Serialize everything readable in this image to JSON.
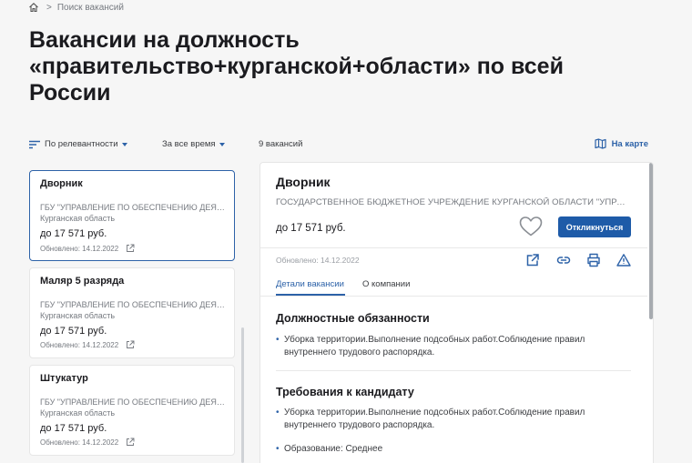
{
  "breadcrumb": {
    "separator": ">",
    "current": "Поиск вакансий"
  },
  "page_title": "Вакансии на должность «правительство+курганской+области» по всей России",
  "filters": {
    "sort_label": "По релевантности",
    "period_label": "За все время",
    "count_label": "9 вакансий",
    "map_label": "На карте"
  },
  "vacancies": [
    {
      "title": "Дворник",
      "company": "ГБУ \"УПРАВЛЕНИЕ ПО ОБЕСПЕЧЕНИЮ ДЕЯТ...",
      "region": "Курганская область",
      "salary": "до 17 571 руб.",
      "updated": "Обновлено: 14.12.2022",
      "selected": true
    },
    {
      "title": "Маляр 5 разряда",
      "company": "ГБУ \"УПРАВЛЕНИЕ ПО ОБЕСПЕЧЕНИЮ ДЕЯТ...",
      "region": "Курганская область",
      "salary": "до 17 571 руб.",
      "updated": "Обновлено: 14.12.2022",
      "selected": false
    },
    {
      "title": "Штукатур",
      "company": "ГБУ \"УПРАВЛЕНИЕ ПО ОБЕСПЕЧЕНИЮ ДЕЯТ...",
      "region": "Курганская область",
      "salary": "до 17 571 руб.",
      "updated": "Обновлено: 14.12.2022",
      "selected": false
    }
  ],
  "detail": {
    "title": "Дворник",
    "company": "ГОСУДАРСТВЕННОЕ БЮДЖЕТНОЕ УЧРЕЖДЕНИЕ КУРГАНСКОЙ ОБЛАСТИ \"УПРАВЛЕНИЕ ПО ОБЕСПЕЧЕНИЮ ДЕЯТЕЛЬНОСТИ",
    "salary": "до 17 571 руб.",
    "respond_label": "Откликнуться",
    "updated": "Обновлено: 14.12.2022",
    "tabs": [
      {
        "label": "Детали вакансии",
        "active": true
      },
      {
        "label": "О компании",
        "active": false
      }
    ],
    "duties_title": "Должностные обязанности",
    "duties": [
      "Уборка территории.Выполнение подсобных работ.Соблюдение правил внутреннего трудового распорядка."
    ],
    "requirements_title": "Требования к кандидату",
    "requirements": [
      "Уборка территории.Выполнение подсобных работ.Соблюдение правил внутреннего трудового распорядка.",
      "Образование: Среднее"
    ]
  },
  "colors": {
    "accent": "#2d62a8",
    "button": "#1e5ba8",
    "background": "#f6f6f6",
    "muted_text": "#767a80"
  },
  "icons": [
    "home-icon",
    "sort-icon",
    "map-icon",
    "external-link-icon",
    "heart-icon",
    "share-icon",
    "link-icon",
    "print-icon",
    "warning-icon"
  ]
}
